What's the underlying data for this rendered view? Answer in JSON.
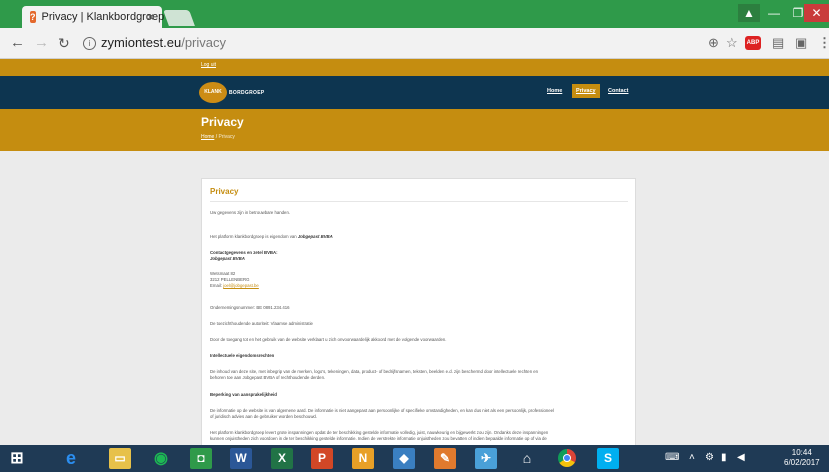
{
  "browser": {
    "tab_title": "Privacy | Klankbordgroep",
    "tab_close": "×",
    "url_host": "zymiontest.eu",
    "url_path": "/privacy",
    "abp_label": "ABP"
  },
  "site": {
    "logout": "Log uit",
    "logo_klank": "KLANK",
    "logo_rest": "BORDGROEP",
    "nav": {
      "home": "Home",
      "privacy": "Privacy",
      "contact": "Contact"
    },
    "banner_title": "Privacy",
    "breadcrumb": {
      "home": "Home",
      "sep": "/",
      "current": "Privacy"
    }
  },
  "content": {
    "heading": "Privacy",
    "intro": "Uw gegevens zijn in betrouwbare handen.",
    "owner_prefix": "Het platform klankbordgroep is eigendom van",
    "owner_name": "Jobgepast BVBA",
    "contact_heading": "Contactgegevens en zetel BVBA:",
    "company": "Jobgepast BVBA",
    "street": "Wetsmaat 82",
    "city": "3212 PELLENBERG",
    "email_label": "Email:",
    "email": "joel@jobgepast.be",
    "company_number": "Ondernemingsnummer: BE 0891.234.416",
    "authority": "De toezichthoudende autoriteit: Vlaamse administratie",
    "agreement": "Door de toegang tot en het gebruik van de website verklaart u zich onvoorwaardelijk akkoord met de volgende voorwaarden.",
    "ip_heading": "Intellectuele eigendomsrechten",
    "ip_text_1": "De inhoud van deze site, met inbegrip van de merken, logo's, tekeningen, data, product- of bedrijfsnamen, teksten, beelden e.d. zijn beschermd door intellectuele rechten en",
    "ip_text_2": "behoren toe aan Jobgepast BVBA of rechthoudende derden.",
    "liability_heading": "Beperking van aansprakelijkheid",
    "liability_1": "De informatie op de website is van algemene aard. De informatie is niet aangepast aan persoonlijke of specifieke omstandigheden, en kan dus niet als een persoonlijk, professioneel",
    "liability_2": "of juridisch advies aan de gebruiker worden beschouwd.",
    "liability_3": "Het platform klankbordgroep levert grote inspanningen opdat de ter beschikking gestelde informatie volledig, juist, nauwkeurig en bijgewerkt zou zijn. Ondanks deze inspanningen",
    "liability_4": "kunnen onjuistheden zich voordoen in de ter beschikking gestelde informatie. Indien de verstrekte informatie onjuistheden zou bevatten of indien bepaalde informatie op of via de"
  },
  "taskbar": {
    "clock_time": "10:44",
    "clock_date": "6/02/2017"
  }
}
